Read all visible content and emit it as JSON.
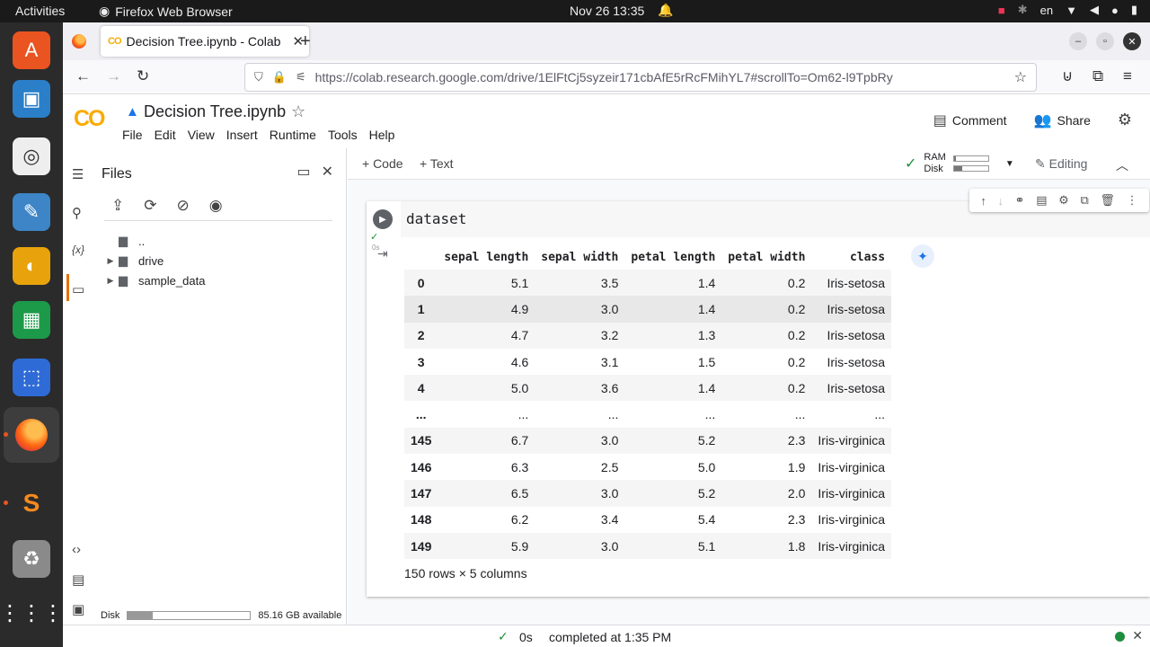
{
  "topbar": {
    "activities": "Activities",
    "app_name": "Firefox Web Browser",
    "clock": "Nov 26  13:35",
    "lang": "en"
  },
  "browser": {
    "tab_title": "Decision Tree.ipynb - Colab",
    "url": "https://colab.research.google.com/drive/1ElFtCj5syzeir171cbAfE5rRcFMihYL7#scrollTo=Om62-l9TpbRy"
  },
  "colab": {
    "logo": "CO",
    "notebook_title": "Decision Tree.ipynb",
    "menu": [
      "File",
      "Edit",
      "View",
      "Insert",
      "Runtime",
      "Tools",
      "Help"
    ],
    "comment_label": "Comment",
    "share_label": "Share"
  },
  "files_panel": {
    "title": "Files",
    "tree": [
      {
        "name": "..",
        "expandable": false
      },
      {
        "name": "drive",
        "expandable": true
      },
      {
        "name": "sample_data",
        "expandable": true
      }
    ],
    "disk_label": "Disk",
    "disk_available": "85.16 GB available",
    "disk_used_fraction": 0.2
  },
  "toolbar": {
    "add_code": "+ Code",
    "add_text": "+ Text",
    "ram_label": "RAM",
    "disk_label": "Disk",
    "ram_fraction": 0.05,
    "disk_fraction": 0.25,
    "editing_label": "Editing"
  },
  "cell": {
    "code": "dataset",
    "exec_time": "0s"
  },
  "dataframe": {
    "columns": [
      "",
      "sepal length",
      "sepal width",
      "petal length",
      "petal width",
      "class"
    ],
    "rows": [
      [
        "0",
        "5.1",
        "3.5",
        "1.4",
        "0.2",
        "Iris-setosa"
      ],
      [
        "1",
        "4.9",
        "3.0",
        "1.4",
        "0.2",
        "Iris-setosa"
      ],
      [
        "2",
        "4.7",
        "3.2",
        "1.3",
        "0.2",
        "Iris-setosa"
      ],
      [
        "3",
        "4.6",
        "3.1",
        "1.5",
        "0.2",
        "Iris-setosa"
      ],
      [
        "4",
        "5.0",
        "3.6",
        "1.4",
        "0.2",
        "Iris-setosa"
      ],
      [
        "...",
        "...",
        "...",
        "...",
        "...",
        "..."
      ],
      [
        "145",
        "6.7",
        "3.0",
        "5.2",
        "2.3",
        "Iris-virginica"
      ],
      [
        "146",
        "6.3",
        "2.5",
        "5.0",
        "1.9",
        "Iris-virginica"
      ],
      [
        "147",
        "6.5",
        "3.0",
        "5.2",
        "2.0",
        "Iris-virginica"
      ],
      [
        "148",
        "6.2",
        "3.4",
        "5.4",
        "2.3",
        "Iris-virginica"
      ],
      [
        "149",
        "5.9",
        "3.0",
        "5.1",
        "1.8",
        "Iris-virginica"
      ]
    ],
    "shape_text": "150 rows × 5 columns"
  },
  "statusbar": {
    "duration": "0s",
    "message": "completed at 1:35 PM"
  },
  "colors": {
    "colab_orange": "#e8710a",
    "colab_yellow": "#f9ab00",
    "success_green": "#1e8e3e",
    "accent_blue": "#1a73e8"
  }
}
